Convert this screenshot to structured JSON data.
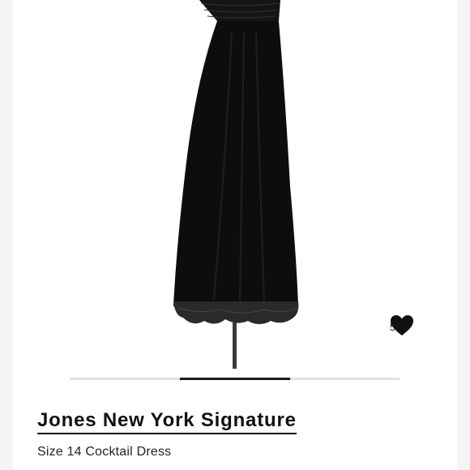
{
  "listing": {
    "brand": "Jones New York Signature",
    "subtitle": "Size 14 Cocktail Dress",
    "likes": {
      "count": "5",
      "icon": "heart-icon"
    }
  },
  "carousel": {
    "active_index": 1,
    "total": 3
  },
  "colors": {
    "dress": "#0d0d0d",
    "text": "#111111",
    "carousel_active": "#1a1a1a",
    "carousel_track": "#e2e2e2"
  }
}
